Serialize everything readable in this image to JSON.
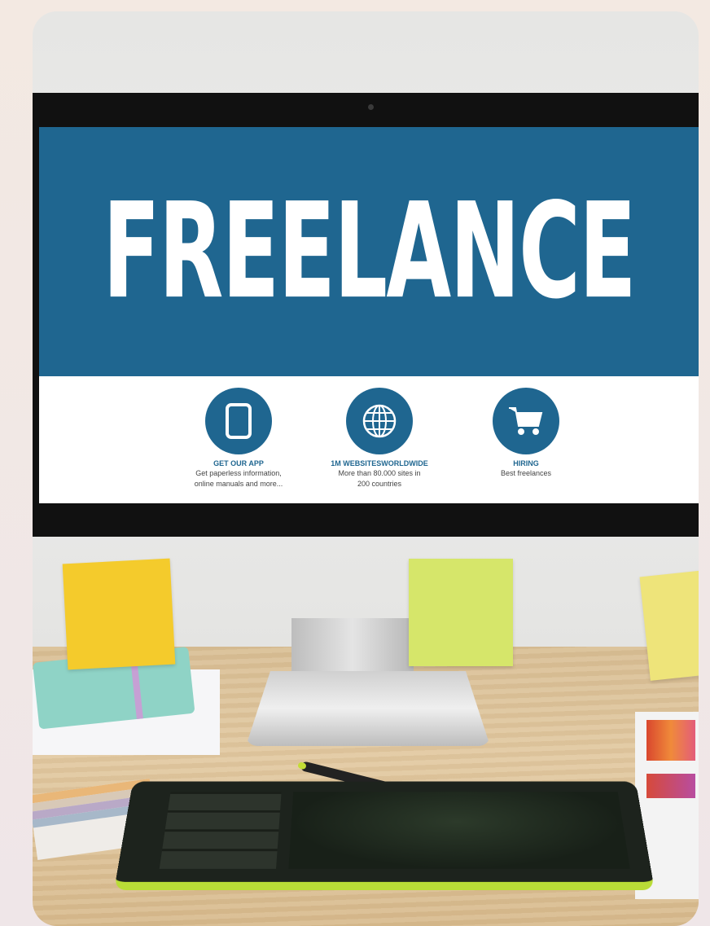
{
  "screen": {
    "headline": "FREELANCE",
    "features": [
      {
        "icon": "tablet-icon",
        "title": "GET OUR APP",
        "desc_line1": "Get paperless information,",
        "desc_line2": "online manuals and more..."
      },
      {
        "icon": "globe-icon",
        "title": "1M WEBSITESWORLDWIDE",
        "desc_line1": "More than 80.000 sites in",
        "desc_line2": "200 countries"
      },
      {
        "icon": "cart-icon",
        "title": "HIRING",
        "desc_line1": "Best freelances",
        "desc_line2": ""
      }
    ]
  },
  "colors": {
    "brand_blue": "#1f6690",
    "sticky_yellow": "#f4cb2c",
    "sticky_green": "#d6e66a",
    "tablet_accent": "#b9dc37"
  }
}
